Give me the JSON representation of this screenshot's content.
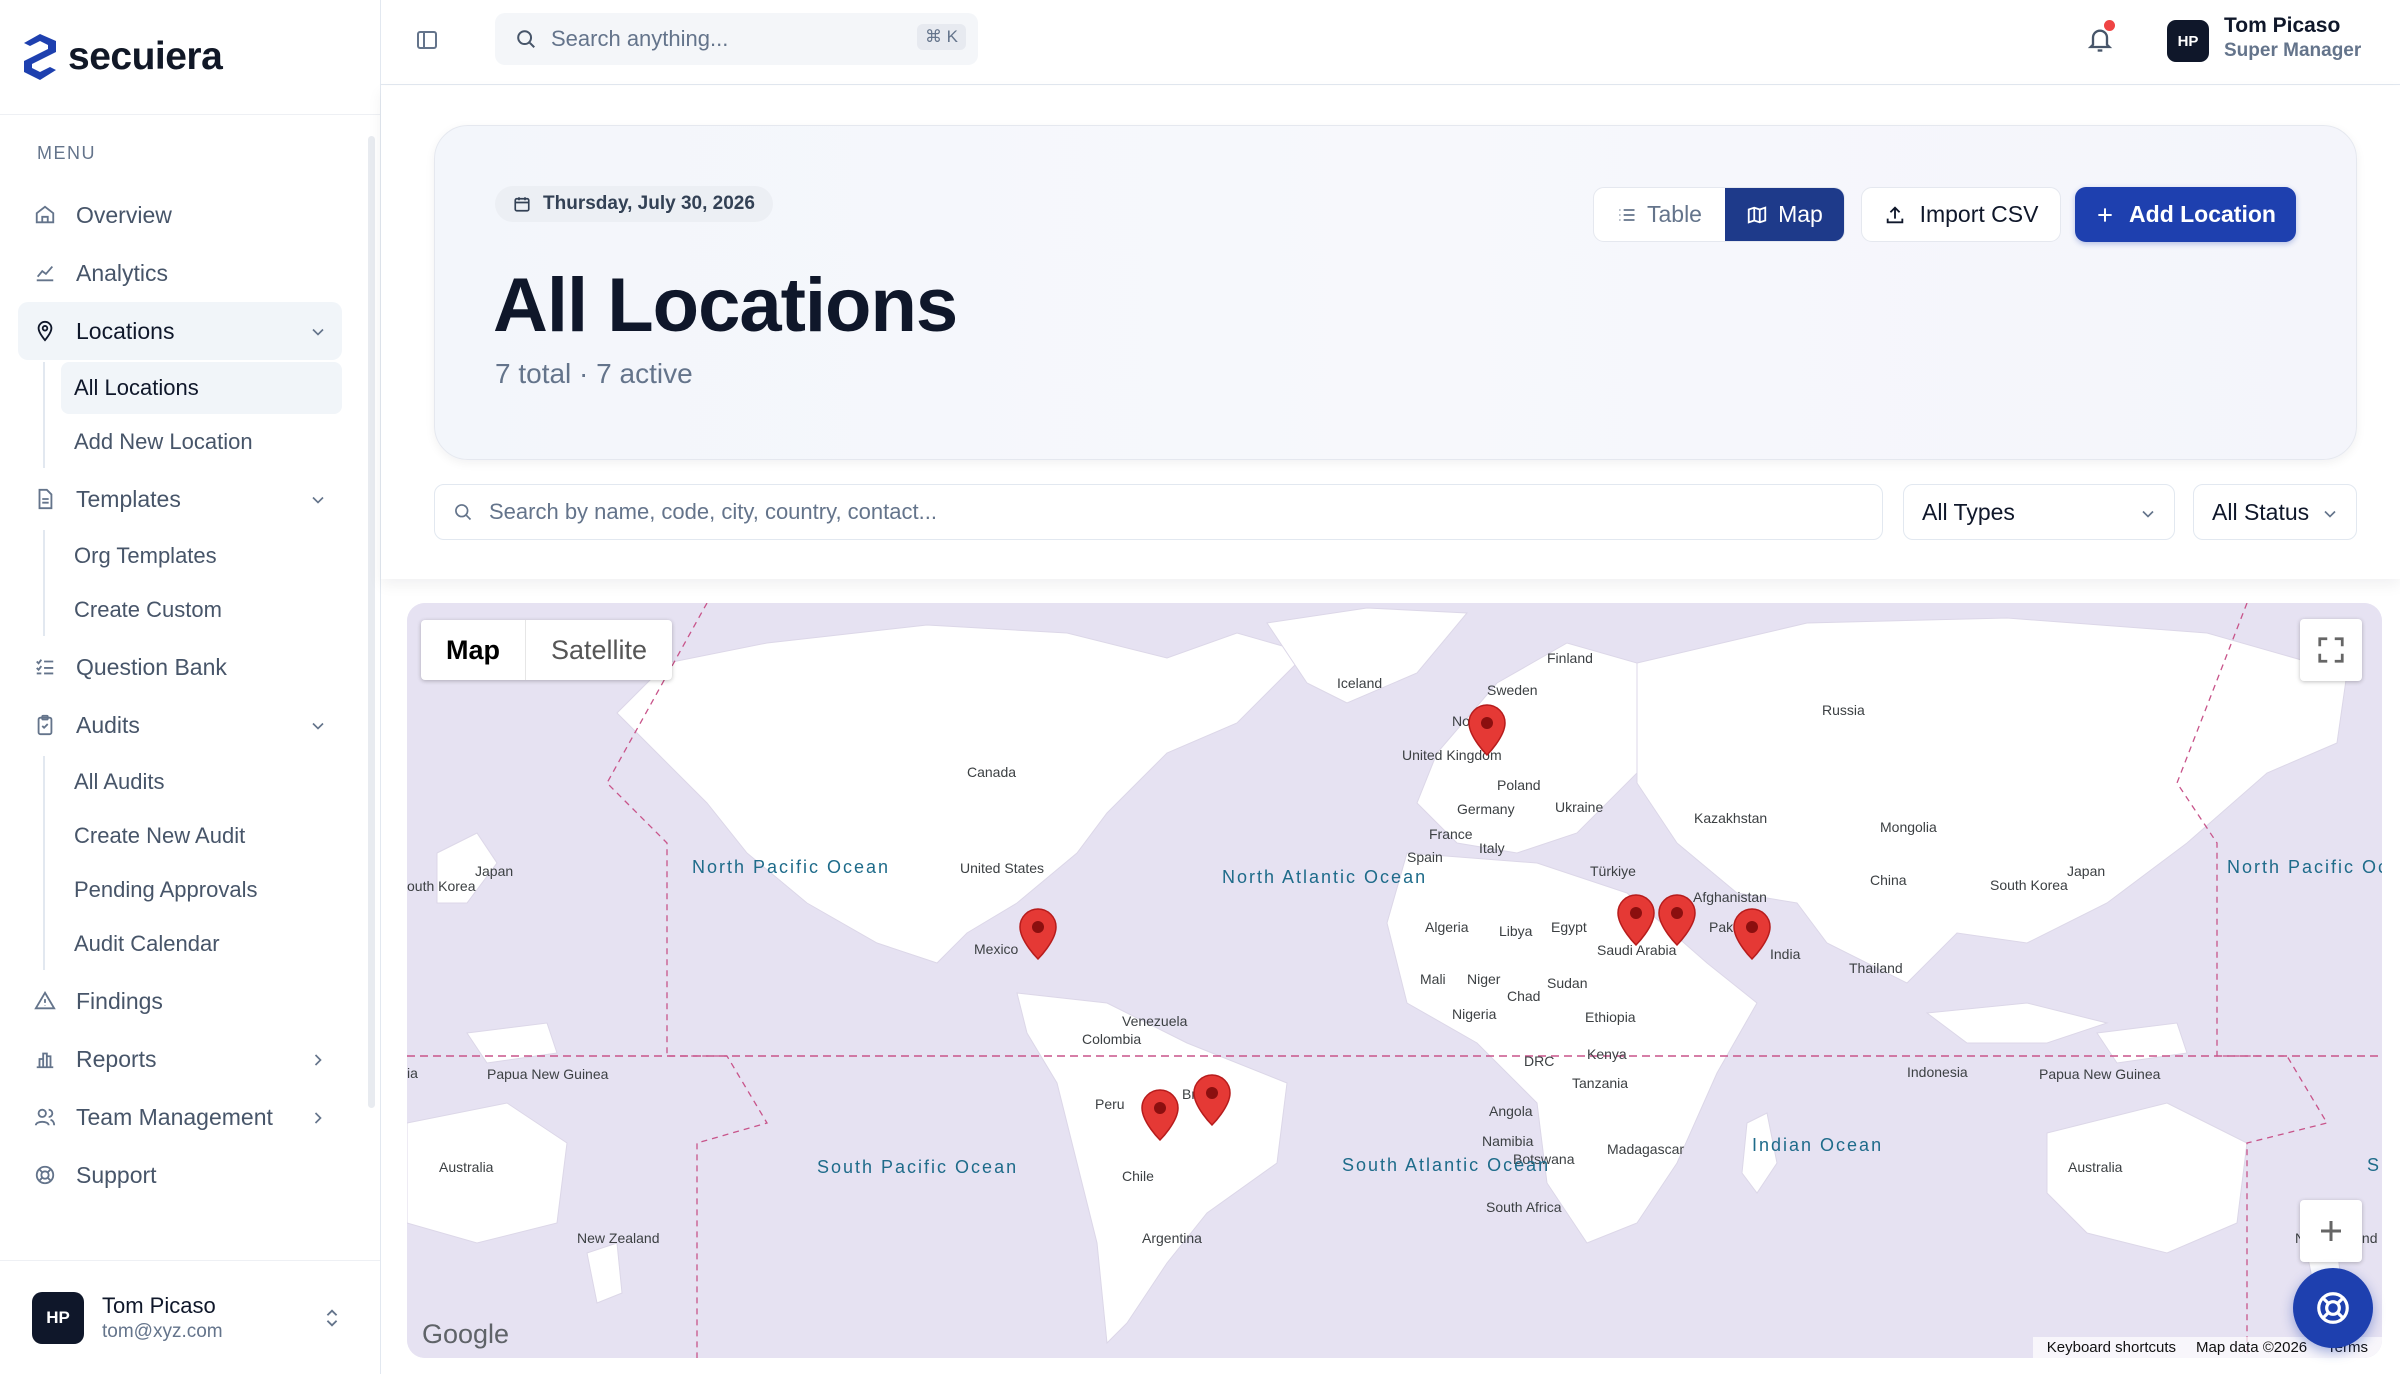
{
  "brand": {
    "name": "secuiera"
  },
  "sidebar": {
    "menu_label": "MENU",
    "items": [
      {
        "label": "Overview"
      },
      {
        "label": "Analytics"
      },
      {
        "label": "Locations",
        "children": [
          {
            "label": "All Locations"
          },
          {
            "label": "Add New Location"
          }
        ]
      },
      {
        "label": "Templates",
        "children": [
          {
            "label": "Org Templates"
          },
          {
            "label": "Create Custom"
          }
        ]
      },
      {
        "label": "Question Bank"
      },
      {
        "label": "Audits",
        "children": [
          {
            "label": "All Audits"
          },
          {
            "label": "Create New Audit"
          },
          {
            "label": "Pending Approvals"
          },
          {
            "label": "Audit Calendar"
          }
        ]
      },
      {
        "label": "Findings"
      },
      {
        "label": "Reports"
      },
      {
        "label": "Team Management"
      },
      {
        "label": "Support"
      }
    ],
    "user": {
      "initials": "HP",
      "name": "Tom Picaso",
      "email": "tom@xyz.com"
    }
  },
  "topbar": {
    "search_placeholder": "Search anything...",
    "shortcut": "⌘ K",
    "user": {
      "initials": "HP",
      "name": "Tom Picaso",
      "role": "Super Manager"
    }
  },
  "header": {
    "date": "Thursday, July 30, 2026",
    "title": "All Locations",
    "subtitle": "7 total · 7 active",
    "view_table": "Table",
    "view_map": "Map",
    "import_label": "Import CSV",
    "add_label": "Add Location"
  },
  "filters": {
    "search_placeholder": "Search by name, code, city, country, contact...",
    "type_value": "All Types",
    "status_value": "All Status"
  },
  "map": {
    "tab_map": "Map",
    "tab_satellite": "Satellite",
    "logo": "Google",
    "attribution": {
      "shortcuts": "Keyboard shortcuts",
      "data": "Map data ©2026",
      "terms": "Terms"
    },
    "marker_count": 7,
    "labels": {
      "finland": "Finland",
      "sweden": "Sweden",
      "iceland": "Iceland",
      "norway": "Norway",
      "russia": "Russia",
      "uk": "United Kingdom",
      "poland": "Poland",
      "germany": "Germany",
      "ukraine": "Ukraine",
      "kazakhstan": "Kazakhstan",
      "france": "France",
      "italy": "Italy",
      "spain": "Spain",
      "mongolia": "Mongolia",
      "turkiye": "Türkiye",
      "afghanistan": "Afghanistan",
      "china": "China",
      "south_korea": "South Korea",
      "japan": "Japan",
      "south_korea_w": "outh Korea",
      "japan_w": "Japan",
      "canada": "Canada",
      "united_states": "United States",
      "mexico": "Mexico",
      "algeria": "Algeria",
      "libya": "Libya",
      "egypt": "Egypt",
      "saudi": "Saudi Arabia",
      "pakistan": "Paki",
      "india": "India",
      "thailand": "Thailand",
      "mali": "Mali",
      "niger": "Niger",
      "sudan": "Sudan",
      "chad": "Chad",
      "nigeria": "Nigeria",
      "ethiopia": "Ethiopia",
      "venezuela": "Venezuela",
      "colombia": "Colombia",
      "drc": "DRC",
      "kenya": "Kenya",
      "tanzania": "Tanzania",
      "indonesia": "Indonesia",
      "png": "Papua New Guinea",
      "png_w": "Papua New Guinea",
      "peru": "Peru",
      "brazil": "Br",
      "angola": "Angola",
      "namibia": "Namibia",
      "botswana": "Botswana",
      "madagascar": "Madagascar",
      "chile": "Chile",
      "australia": "Australia",
      "australia_w": "Australia",
      "south_africa": "South Africa",
      "argentina": "Argentina",
      "new_zealand": "New Zealand",
      "new_zealand_w": "New Zealand",
      "ia": "ia",
      "np_ocean": "North Pacific Ocean",
      "na_ocean": "North Atlantic Ocean",
      "sp_ocean": "South Pacific Ocean",
      "sa_ocean": "South Atlantic Ocean",
      "in_ocean": "Indian Ocean",
      "np_ocean_e": "North Pacific Ocean",
      "s_edge": "S P O"
    }
  },
  "colors": {
    "primary": "#1e40af",
    "active_toggle": "#1e3a8a",
    "marker": "#e53935",
    "map_water": "#e6e2f2",
    "map_land": "#ffffff"
  }
}
